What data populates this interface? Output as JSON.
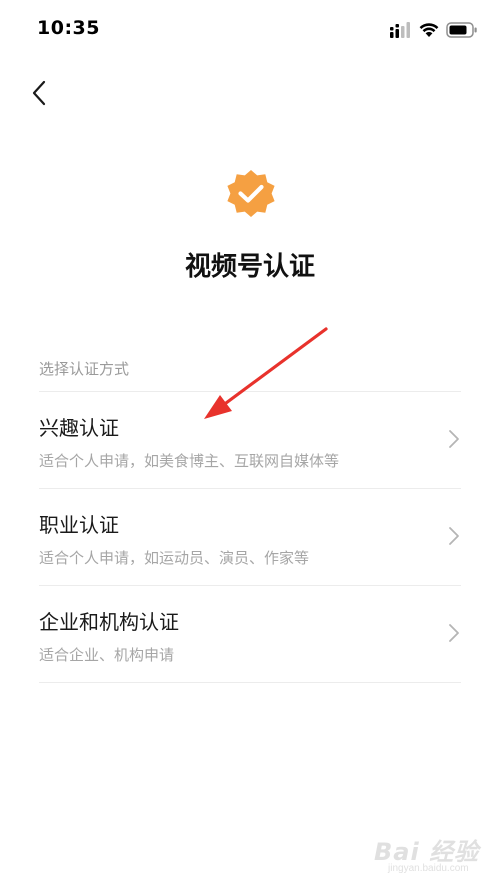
{
  "status_bar": {
    "time": "10:35"
  },
  "header": {
    "back_icon": "chevron-left-icon",
    "badge_icon": "verified-check-badge-icon",
    "title": "视频号认证"
  },
  "colors": {
    "badge": "#F5A042",
    "annotation_arrow": "#E8322C"
  },
  "section": {
    "label": "选择认证方式",
    "options": [
      {
        "title": "兴趣认证",
        "description": "适合个人申请，如美食博主、互联网自媒体等"
      },
      {
        "title": "职业认证",
        "description": "适合个人申请，如运动员、演员、作家等"
      },
      {
        "title": "企业和机构认证",
        "description": "适合企业、机构申请"
      }
    ]
  },
  "watermark": {
    "main": "Bai 经验",
    "sub": "jingyan.baidu.com"
  }
}
